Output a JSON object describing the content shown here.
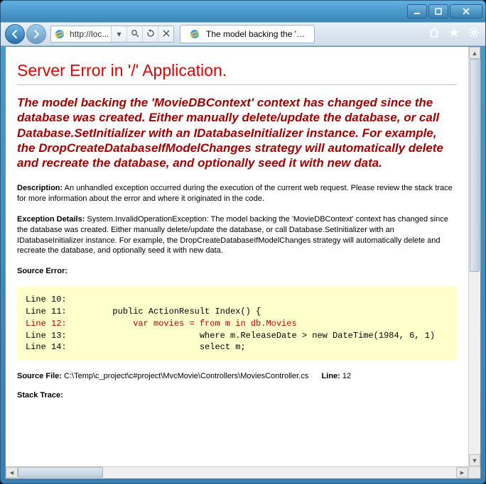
{
  "window": {
    "min_tooltip": "Minimize",
    "max_tooltip": "Maximize",
    "close_tooltip": "Close"
  },
  "navbar": {
    "url": "http://loc...",
    "tab_title": "The model backing the 'Movi..."
  },
  "error": {
    "title": "Server Error in '/' Application.",
    "message": "The model backing the 'MovieDBContext' context has changed since the database was created. Either manually delete/update the database, or call Database.SetInitializer with an IDatabaseInitializer instance. For example, the DropCreateDatabaseIfModelChanges strategy will automatically delete and recreate the database, and optionally seed it with new data.",
    "description_label": "Description:",
    "description_text": "An unhandled exception occurred during the execution of the current web request. Please review the stack trace for more information about the error and where it originated in the code.",
    "exception_label": "Exception Details:",
    "exception_text": "System.InvalidOperationException: The model backing the 'MovieDBContext' context has changed since the database was created. Either manually delete/update the database, or call Database.SetInitializer with an IDatabaseInitializer instance. For example, the DropCreateDatabaseIfModelChanges strategy will automatically delete and recreate the database, and optionally seed it with new data.",
    "source_error_label": "Source Error:",
    "code": {
      "line10": "Line 10:",
      "line11": "Line 11:         public ActionResult Index() {",
      "line12": "Line 12:             var movies = from m in db.Movies",
      "line13": "Line 13:                          where m.ReleaseDate > new DateTime(1984, 6, 1)",
      "line14": "Line 14:                          select m;"
    },
    "source_file_label": "Source File:",
    "source_file": "C:\\Temp\\c_project\\c#project\\MvcMovie\\Controllers\\MoviesController.cs",
    "line_label": "Line:",
    "line_num": "12",
    "stack_trace_label": "Stack Trace:"
  }
}
